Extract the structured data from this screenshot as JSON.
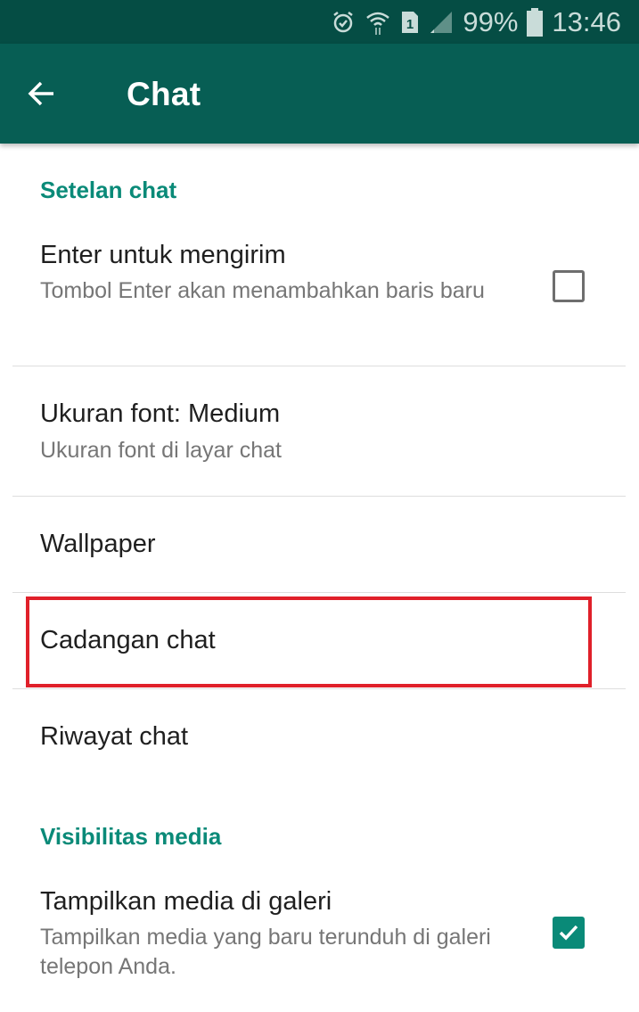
{
  "status_bar": {
    "icons": [
      "alarm-icon",
      "wifi-icon",
      "sim-1-icon",
      "signal-icon"
    ],
    "battery_percent": "99%",
    "time": "13:46"
  },
  "app_bar": {
    "back_icon": "arrow-left-icon",
    "title": "Chat"
  },
  "sections": [
    {
      "header": "Setelan chat",
      "items": [
        {
          "title": "Enter untuk mengirim",
          "subtitle": "Tombol Enter akan menambahkan baris baru",
          "checkbox": false
        },
        {
          "title": "Ukuran font: Medium",
          "subtitle": "Ukuran font di layar chat"
        },
        {
          "title": "Wallpaper"
        },
        {
          "title": "Cadangan chat",
          "highlighted": true
        },
        {
          "title": "Riwayat chat"
        }
      ]
    },
    {
      "header": "Visibilitas media",
      "items": [
        {
          "title": "Tampilkan media di galeri",
          "subtitle": "Tampilkan media yang baru terunduh di galeri telepon Anda.",
          "checkbox": true
        }
      ]
    }
  ],
  "colors": {
    "status_bar": "#054d44",
    "app_bar": "#075e54",
    "accent": "#0a8a78",
    "highlight_box": "#e0202a"
  }
}
